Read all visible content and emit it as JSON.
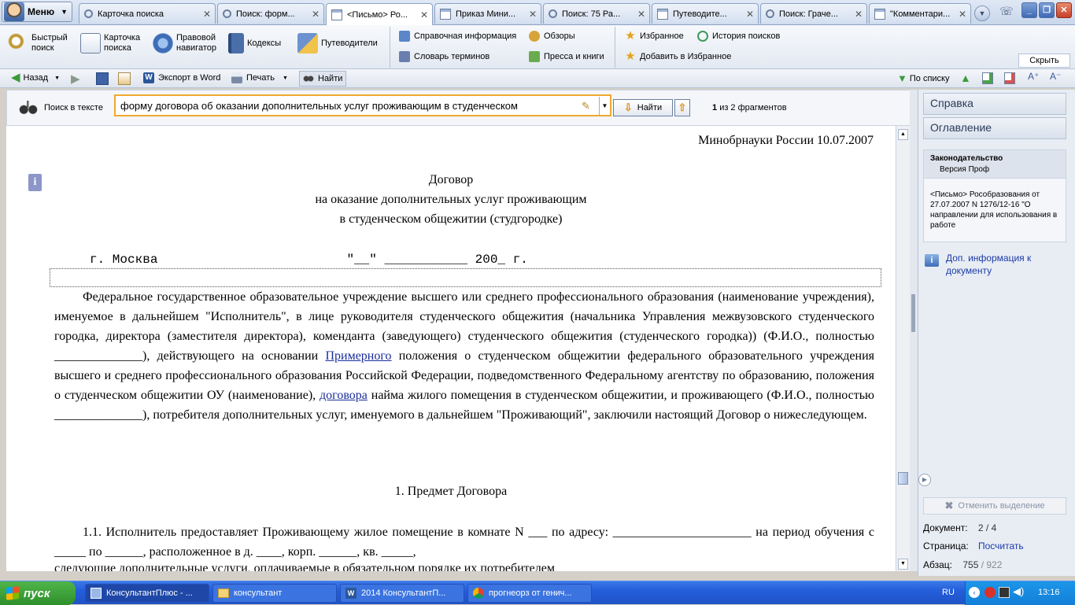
{
  "menu": {
    "label": "Меню"
  },
  "tabs": [
    {
      "label": "Карточка поиска",
      "icon": "search-card-icon"
    },
    {
      "label": "Поиск: форм...",
      "icon": "search-icon"
    },
    {
      "label": "<Письмо> Ро...",
      "icon": "document-icon"
    },
    {
      "label": "Приказ Мини...",
      "icon": "document-icon"
    },
    {
      "label": "Поиск: 75 Ра...",
      "icon": "search-icon"
    },
    {
      "label": "Путеводите...",
      "icon": "document-icon"
    },
    {
      "label": "Поиск: Граче...",
      "icon": "search-icon"
    },
    {
      "label": "\"Комментари...",
      "icon": "document-icon"
    }
  ],
  "toolbar_main": {
    "quick_search": "Быстрый\nпоиск",
    "search_card": "Карточка\nпоиска",
    "legal_nav": "Правовой\nнавигатор",
    "codes": "Кодексы",
    "guides": "Путеводители",
    "reference_info": "Справочная информация",
    "glossary": "Словарь терминов",
    "reviews": "Обзоры",
    "press_books": "Пресса и книги",
    "favorites": "Избранное",
    "add_favorites": "Добавить в Избранное",
    "search_history": "История поисков",
    "hide": "Скрыть"
  },
  "toolbar_secondary": {
    "back": "Назад",
    "export_word": "Экспорт в Word",
    "print": "Печать",
    "find": "Найти",
    "by_list": "По списку"
  },
  "search_in_text": {
    "label": "Поиск в тексте",
    "value": "форму договора об оказании дополнительных услуг проживающим в студенческом",
    "find_button": "Найти",
    "result_current": "1",
    "result_text": "из 2 фрагментов"
  },
  "document": {
    "header_date": "Минобрнауки России 10.07.2007",
    "title_line1": "Договор",
    "title_line2": "на оказание дополнительных услуг проживающим",
    "title_line3": "в студенческом общежитии (студгородке)",
    "city_line": "г. Москва                         \"__\" ___________ 200_ г.",
    "para1_a": "Федеральное государственное образовательное учреждение высшего или среднего профессионального образования (наименование учреждения), именуемое в дальнейшем \"Исполнитель\", в лице руководителя студенческого общежития (начальника Управления межвузовского студенческого городка, директора (заместителя директора), коменданта (заведующего) студенческого общежития (студенческого городка)) (Ф.И.О., полностью ______________), действующего на основании ",
    "para1_link1": "Примерного",
    "para1_b": " положения о студенческом общежитии федерального образовательного учреждения высшего и среднего профессионального образования Российской Федерации, подведомственного Федеральному агентству по образованию, положения о студенческом общежитии ОУ (наименование), ",
    "para1_link2": "договора",
    "para1_c": " найма жилого помещения в студенческом общежитии, и проживающего (Ф.И.О., полностью ______________), потребителя дополнительных услуг, именуемого в дальнейшем \"Проживающий\", заключили настоящий Договор о нижеследующем.",
    "section1": "1. Предмет Договора",
    "para2": "1.1. Исполнитель предоставляет Проживающему жилое помещение в комнате N ___ по адресу: ______________________ на период обучения с _____ по ______, расположенное в д. ____, корп. ______, кв. _____,",
    "para2_cut": "следующие дополнительные услуги, оплачиваемые в обязательном порядке их потребителем"
  },
  "right_pane": {
    "help": "Справка",
    "contents": "Оглавление",
    "info_title": "Законодательство",
    "info_subtitle": "Версия Проф",
    "doc_name": "<Письмо> Рособразования от 27.07.2007 N 1276/12-16 \"О направлении для использования в работе",
    "extra_info": "Доп. информация к документу",
    "cancel_selection": "Отменить выделение",
    "doc_label": "Документ:",
    "doc_value": "2 / 4",
    "page_label": "Страница:",
    "page_value": "Посчитать",
    "para_label": "Абзац:",
    "para_current": "755",
    "para_total": "/ 922"
  },
  "taskbar": {
    "start": "пуск",
    "items": [
      "КонсультантПлюс - ...",
      "консультант",
      "2014 КонсультантП...",
      "прогнеорз от генич..."
    ],
    "lang": "RU",
    "clock": "13:16"
  }
}
